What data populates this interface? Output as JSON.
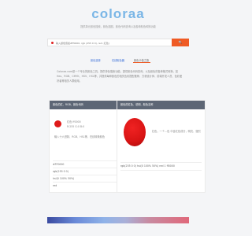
{
  "logo": "coloraa",
  "tagline": "提供单元颜色搜索，颜色选图，颜色代码查询以及各种颜色转换功能",
  "search": {
    "value": "输入颜色值如#ff0000, rgb (255 0 0), red, 红色)",
    "button": "🔍"
  },
  "tabs": [
    "颜色选择",
    "在线取色器",
    "颜色卡值之旅"
  ],
  "intro": "Coloraa.com是一个专业的颜色工具，提供单色搜索功能，提供颜色代码查询，以及颜色的各种格式转换，如Hex、RGB、CMYK、HSV、HSL等，并提供每种颜色的相关色彩搭配推荐，方便设计师、前端开发人员、色彩爱好者等相关人群使用。",
  "panel_left": {
    "title": "颜色的红、RGB、颜色代码",
    "lines": [
      "红色 ff0000",
      "R:255 G:0 B:0"
    ],
    "desc": "输入十六进制、RGB、HSL等，在线转换颜色",
    "codes": [
      "#FF0000",
      "rgb(255 0 0)",
      "hsl(0 100% 50%)",
      "red"
    ]
  },
  "panel_right": {
    "title": "颜色的红色、说明、颜色名称",
    "desc": "红色，一个…色 中含红色成分，明亮、强烈",
    "code": "rgb(255 0 0) hsl(0 100% 50%) red 1 ff0000"
  },
  "colors": {
    "accent": "#ef5a24",
    "brand": "#7ab6e6",
    "swatch": "#de1a1a"
  }
}
